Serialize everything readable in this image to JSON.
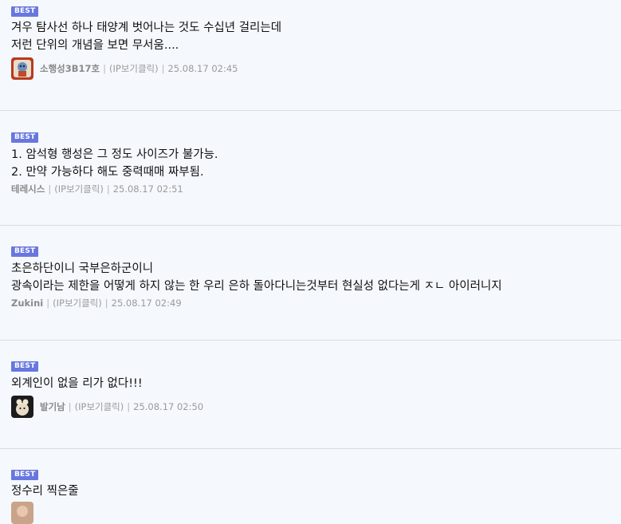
{
  "comments": [
    {
      "badge": "BEST",
      "lines": [
        "겨우 탐사선 하나 태양계 벗어나는 것도 수십년 걸리는데",
        "저런 단위의 개념을 보면 무서움...."
      ],
      "nick": "소행성3B17호",
      "ip": "(IP보기클릭)",
      "date": "25.08.17 02:45"
    },
    {
      "badge": "BEST",
      "lines": [
        "1. 암석형 행성은 그 정도 사이즈가 불가능.",
        "2. 만약 가능하다 해도 중력때매 짜부됨."
      ],
      "nick": "테레시스",
      "ip": "(IP보기클릭)",
      "date": "25.08.17 02:51"
    },
    {
      "badge": "BEST",
      "lines": [
        "초은하단이니 국부은하군이니",
        "광속이라는 제한을 어떻게 하지 않는 한 우리 은하 돌아다니는것부터 현실성 없다는게 ㅈㄴ 아이러니지"
      ],
      "nick": "Zukini",
      "ip": "(IP보기클릭)",
      "date": "25.08.17 02:49"
    },
    {
      "badge": "BEST",
      "lines": [
        "외계인이 없을 리가 없다!!!"
      ],
      "nick": "발기남",
      "ip": "(IP보기클릭)",
      "date": "25.08.17 02:50"
    },
    {
      "badge": "BEST",
      "lines": [
        "정수리 찍은줄"
      ]
    }
  ],
  "separator": "|"
}
